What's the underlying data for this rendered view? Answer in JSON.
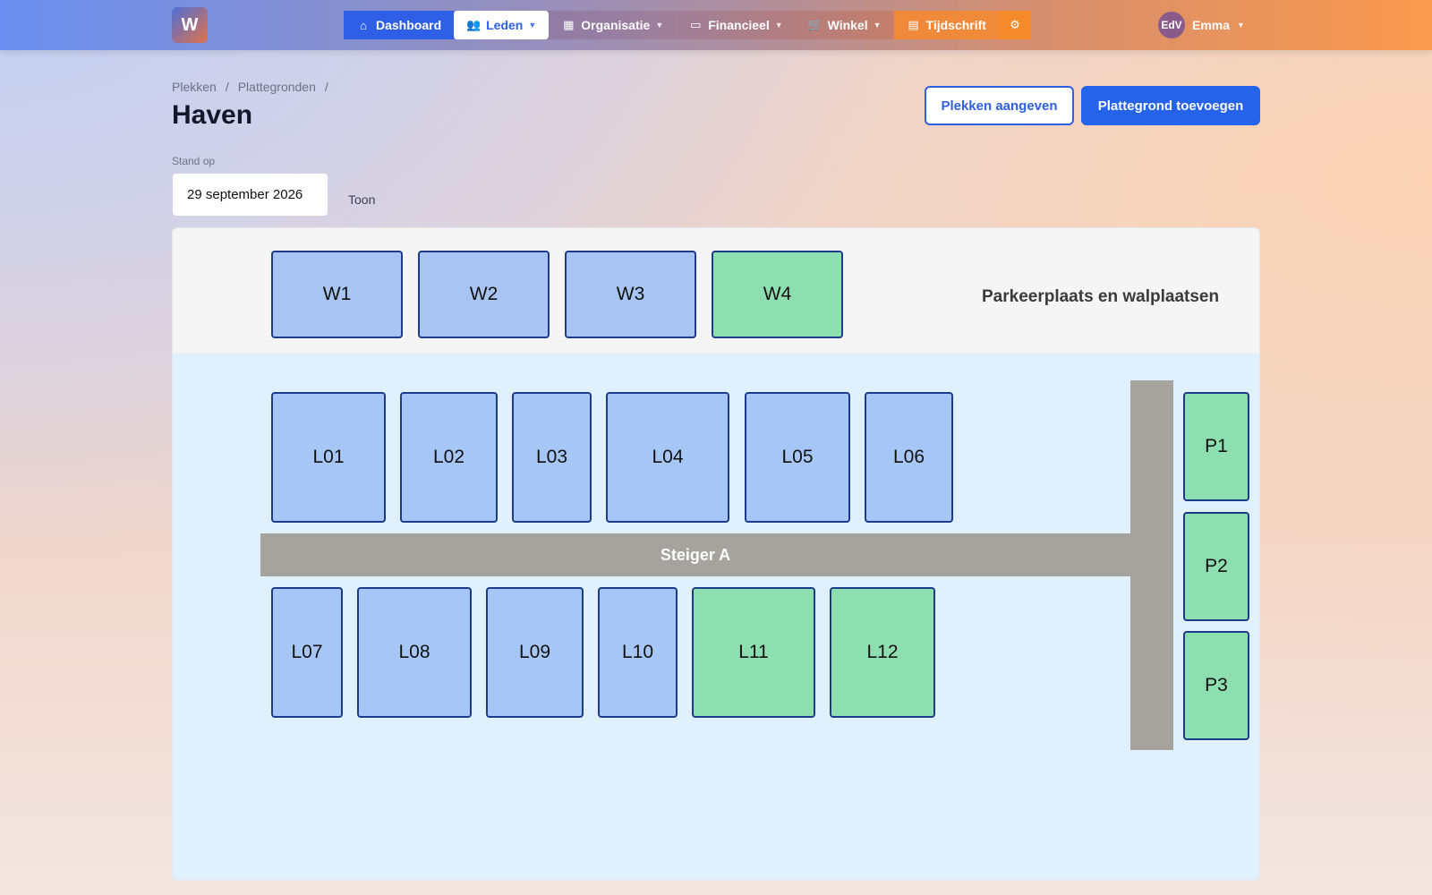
{
  "app": {
    "logo_text": "W"
  },
  "nav": {
    "items": [
      {
        "label": "Dashboard",
        "icon": "home-icon",
        "has_dropdown": false
      },
      {
        "label": "Leden",
        "icon": "users-icon",
        "has_dropdown": true
      },
      {
        "label": "Organisatie",
        "icon": "building-icon",
        "has_dropdown": true
      },
      {
        "label": "Financieel",
        "icon": "money-icon",
        "has_dropdown": true
      },
      {
        "label": "Winkel",
        "icon": "cart-icon",
        "has_dropdown": true
      },
      {
        "label": "Tijdschrift",
        "icon": "magazine-icon",
        "has_dropdown": false
      }
    ],
    "settings_icon": "gear-icon",
    "user": {
      "initials": "EdV",
      "name": "Emma"
    }
  },
  "breadcrumb": [
    "Plekken",
    "Plattegronden"
  ],
  "page": {
    "title": "Haven",
    "btn_mark_spots": "Plekken aangeven",
    "btn_add_map": "Plattegrond toevoegen",
    "stand_label": "Stand op",
    "date_value": "29 september 2026",
    "show_label": "Toon"
  },
  "map": {
    "area_label": "Parkeerplaats en walplaatsen",
    "pier_label": "Steiger A",
    "spots_top": [
      "W1",
      "W2",
      "W3",
      "W4"
    ],
    "spots_row1": [
      "L01",
      "L02",
      "L03",
      "L04",
      "L05",
      "L06"
    ],
    "spots_row2": [
      "L07",
      "L08",
      "L09",
      "L10",
      "L11",
      "L12"
    ],
    "spots_parking": [
      "P1",
      "P2",
      "P3"
    ],
    "colors": {
      "occupied": "#a6c6f6",
      "free": "#8ddfb0",
      "pier": "#a6a29e",
      "water": "#e0f0fc"
    }
  }
}
